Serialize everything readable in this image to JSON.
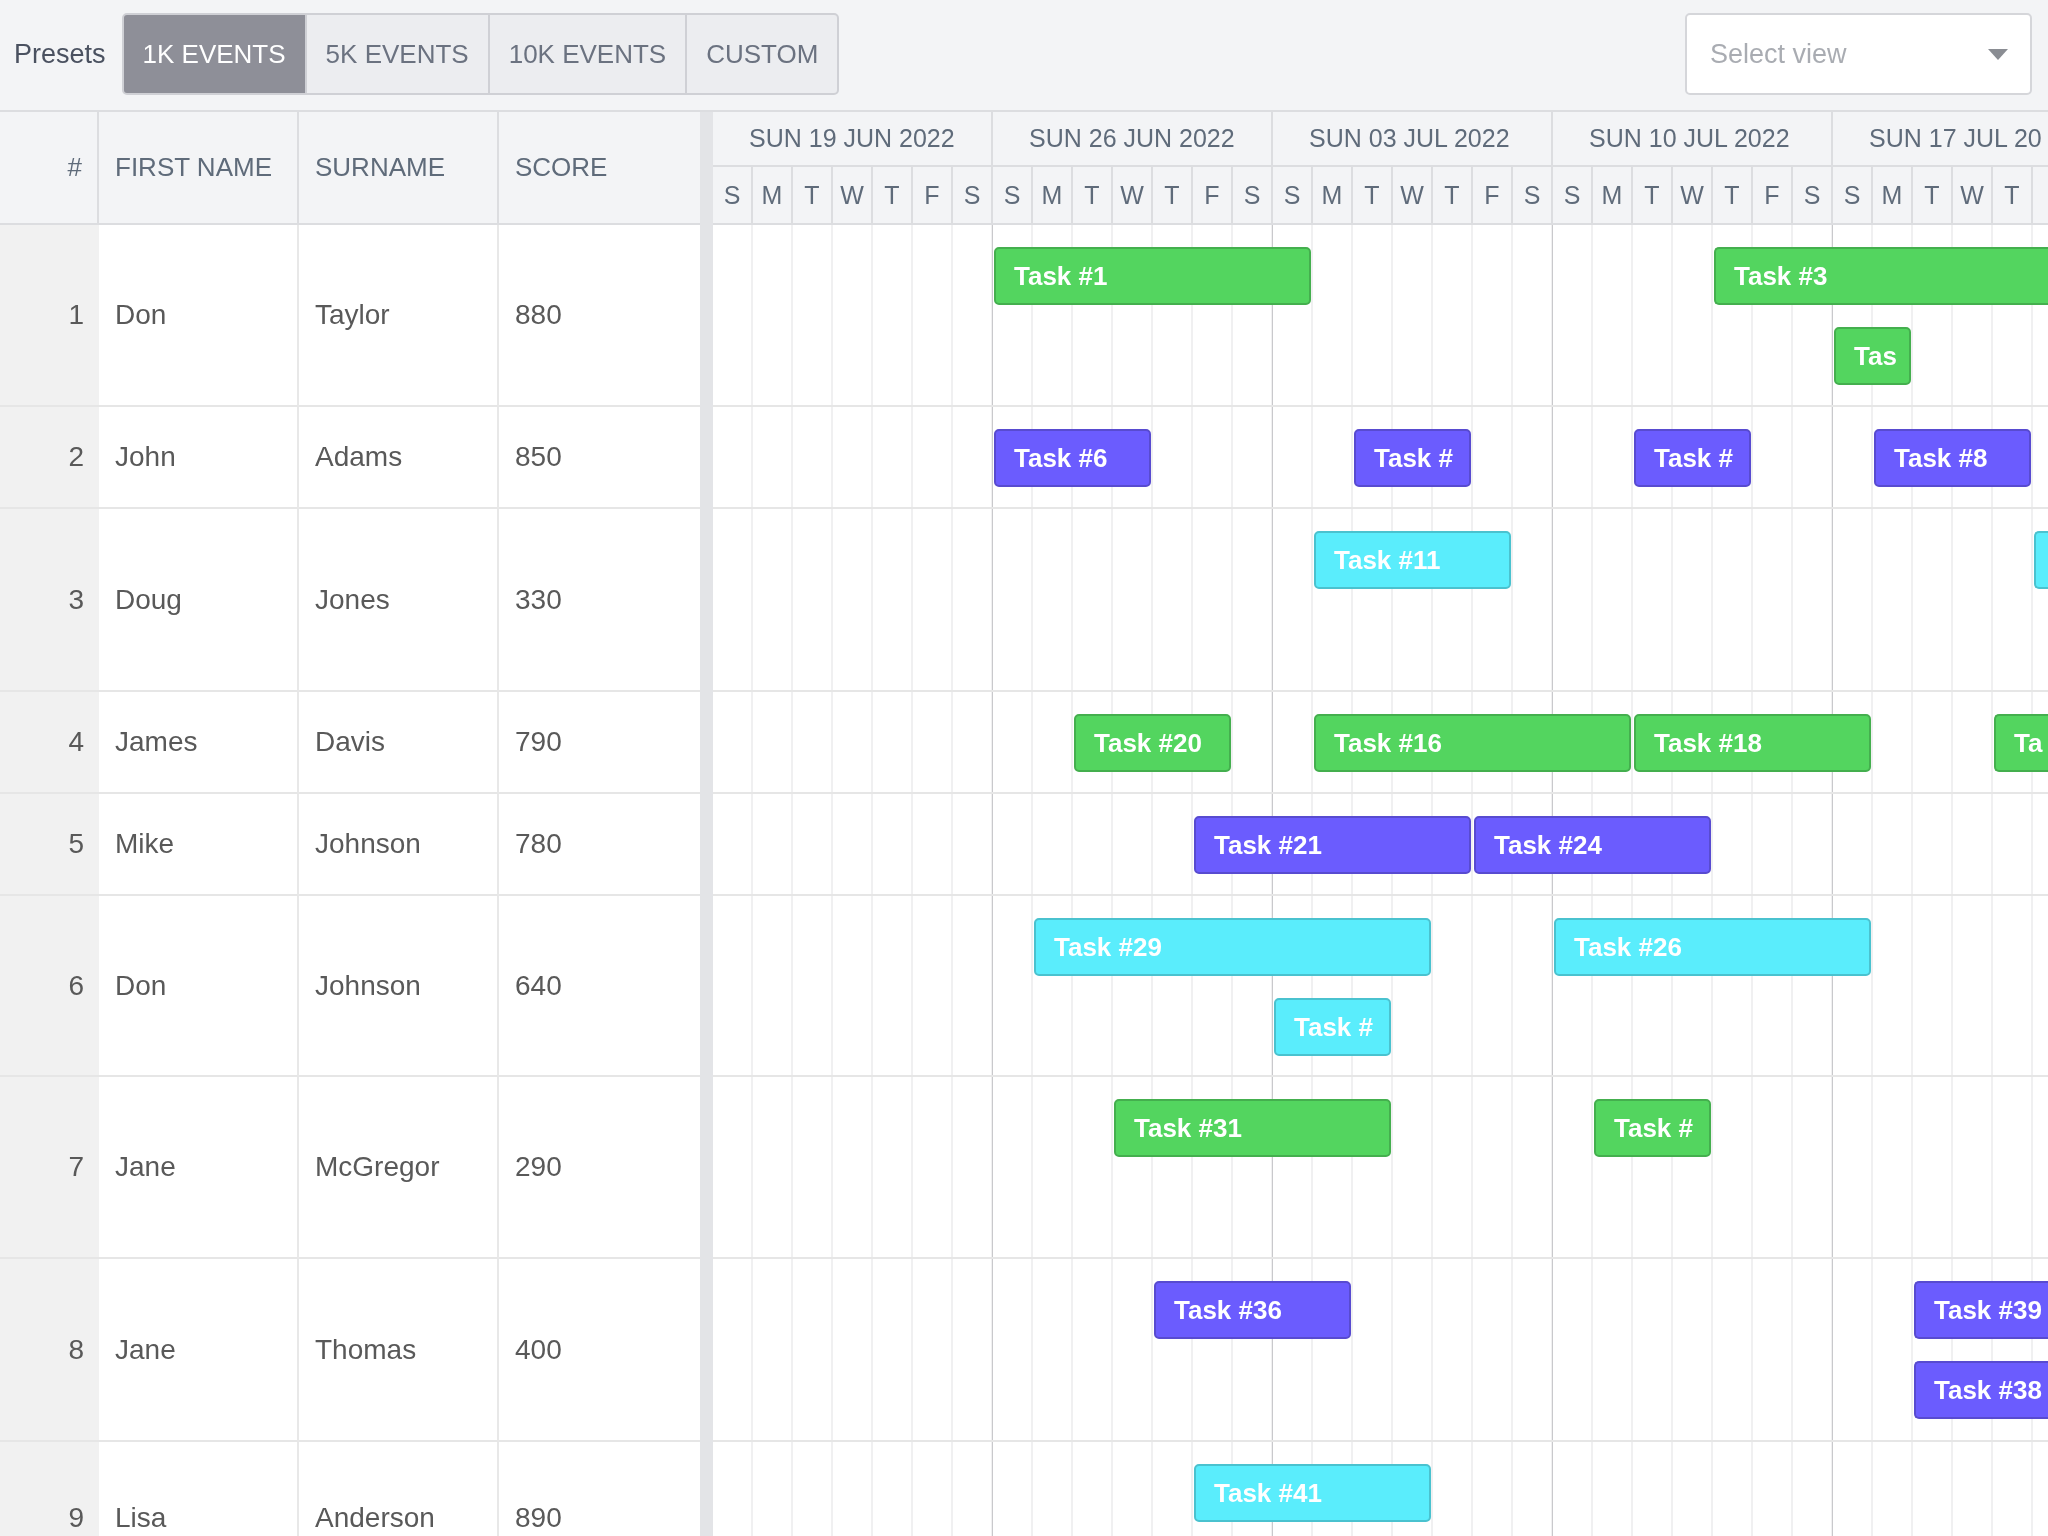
{
  "toolbar": {
    "presets_label": "Presets",
    "presets": [
      {
        "label": "1K EVENTS",
        "selected": true
      },
      {
        "label": "5K EVENTS",
        "selected": false
      },
      {
        "label": "10K EVENTS",
        "selected": false
      },
      {
        "label": "CUSTOM",
        "selected": false
      }
    ],
    "view_select": {
      "placeholder": "Select view"
    }
  },
  "table": {
    "columns": [
      "#",
      "FIRST NAME",
      "SURNAME",
      "SCORE"
    ]
  },
  "timeline": {
    "weeks": [
      {
        "label": "SUN 19 JUN 2022",
        "days": [
          "S",
          "M",
          "T",
          "W",
          "T",
          "F",
          "S"
        ]
      },
      {
        "label": "SUN 26 JUN 2022",
        "days": [
          "S",
          "M",
          "T",
          "W",
          "T",
          "F",
          "S"
        ]
      },
      {
        "label": "SUN 03 JUL 2022",
        "days": [
          "S",
          "M",
          "T",
          "W",
          "T",
          "F",
          "S"
        ]
      },
      {
        "label": "SUN 10 JUL 2022",
        "days": [
          "S",
          "M",
          "T",
          "W",
          "T",
          "F",
          "S"
        ]
      },
      {
        "label": "SUN 17 JUL 20",
        "days": [
          "S",
          "M",
          "T",
          "W",
          "T"
        ]
      }
    ]
  },
  "rows": [
    {
      "number": "1",
      "first_name": "Don",
      "surname": "Taylor",
      "score": "880",
      "events": [
        {
          "label": "Task #1",
          "color": "#53d55f"
        },
        {
          "label": "Task #3",
          "color": "#53d55f"
        },
        {
          "label": "Tas",
          "color": "#53d55f"
        }
      ]
    },
    {
      "number": "2",
      "first_name": "John",
      "surname": "Adams",
      "score": "850",
      "events": [
        {
          "label": "Task #6",
          "color": "#6b5cfe"
        },
        {
          "label": "Task #",
          "color": "#6b5cfe"
        },
        {
          "label": "Task #",
          "color": "#6b5cfe"
        },
        {
          "label": "Task #8",
          "color": "#6b5cfe"
        }
      ]
    },
    {
      "number": "3",
      "first_name": "Doug",
      "surname": "Jones",
      "score": "330",
      "events": [
        {
          "label": "Task #11",
          "color": "#5aedfc"
        },
        {
          "color": "#5aedfc"
        }
      ]
    },
    {
      "number": "4",
      "first_name": "James",
      "surname": "Davis",
      "score": "790",
      "events": [
        {
          "label": "Task #20",
          "color": "#53d55f"
        },
        {
          "label": "Task #16",
          "color": "#53d55f"
        },
        {
          "label": "Task #18",
          "color": "#53d55f"
        },
        {
          "label": "Ta",
          "color": "#53d55f"
        }
      ]
    },
    {
      "number": "5",
      "first_name": "Mike",
      "surname": "Johnson",
      "score": "780",
      "events": [
        {
          "label": "Task #21",
          "color": "#6b5cfe"
        },
        {
          "label": "Task #24",
          "color": "#6b5cfe"
        }
      ]
    },
    {
      "number": "6",
      "first_name": "Don",
      "surname": "Johnson",
      "score": "640",
      "events": [
        {
          "label": "Task #29",
          "color": "#5aedfc"
        },
        {
          "label": "Task #26",
          "color": "#5aedfc"
        },
        {
          "label": "Task #",
          "color": "#5aedfc"
        }
      ]
    },
    {
      "number": "7",
      "first_name": "Jane",
      "surname": "McGregor",
      "score": "290",
      "events": [
        {
          "label": "Task #31",
          "color": "#53d55f"
        },
        {
          "label": "Task #",
          "color": "#53d55f"
        }
      ]
    },
    {
      "number": "8",
      "first_name": "Jane",
      "surname": "Thomas",
      "score": "400",
      "events": [
        {
          "label": "Task #36",
          "color": "#6b5cfe"
        },
        {
          "label": "Task #39",
          "color": "#6b5cfe"
        },
        {
          "label": "Task #38",
          "color": "#6b5cfe"
        }
      ]
    },
    {
      "number": "9",
      "first_name": "Lisa",
      "surname": "Anderson",
      "score": "890",
      "events": [
        {
          "label": "Task #41",
          "color": "#5aedfc"
        }
      ]
    }
  ]
}
